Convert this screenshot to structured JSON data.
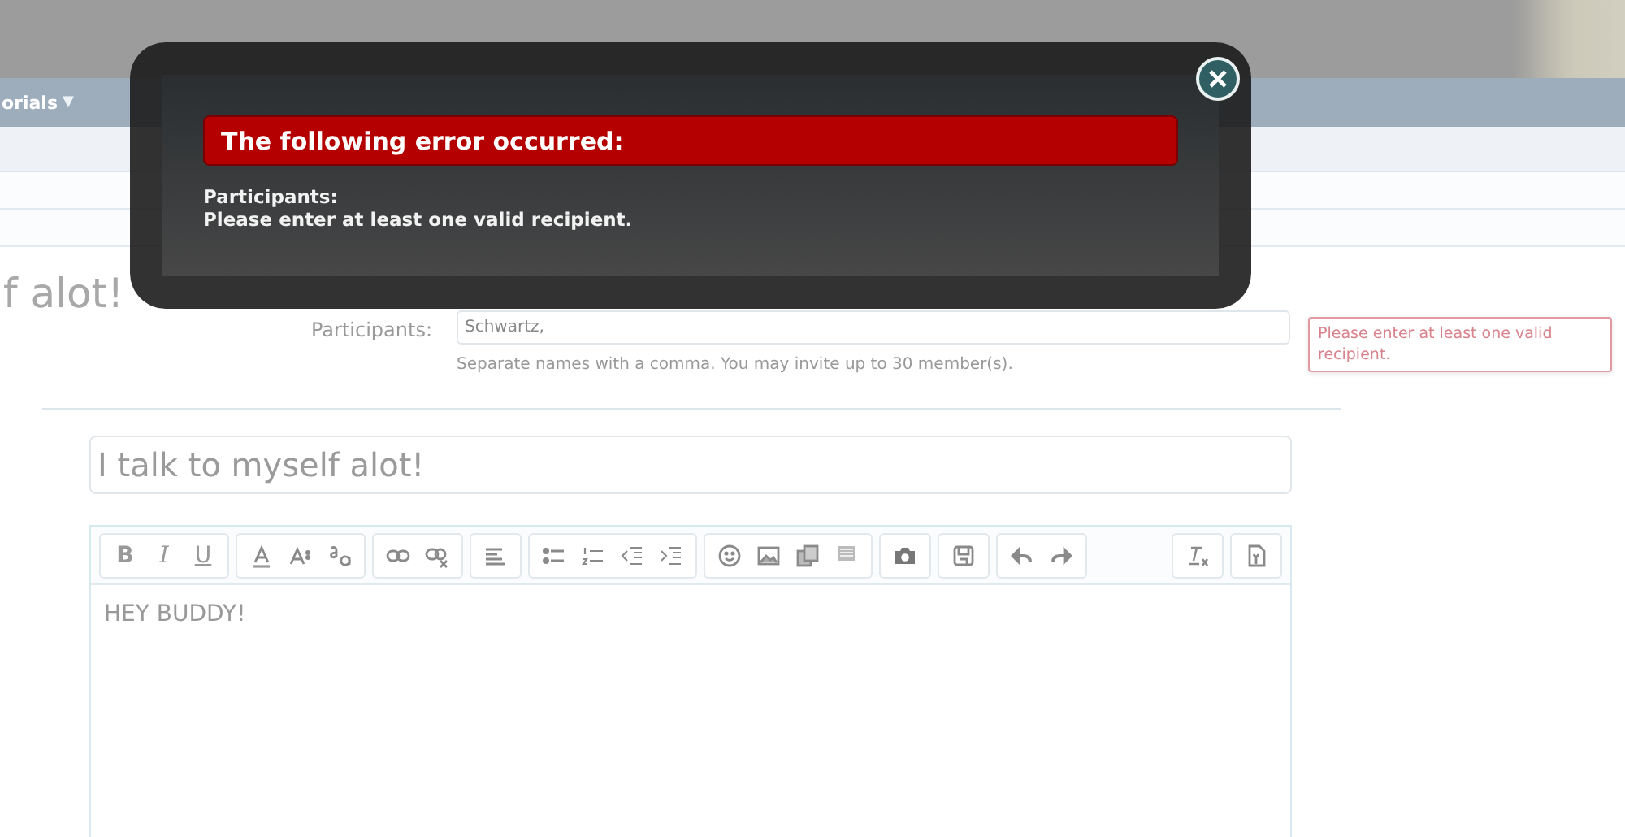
{
  "nav": {
    "items": [
      {
        "label": "orials",
        "caret": "▼"
      }
    ]
  },
  "page_title": "f alot!",
  "form": {
    "participants_label": "Participants:",
    "participants_value": "Schwartz,",
    "participants_hint": "Separate names with a comma. You may invite up to 30 member(s).",
    "participants_error": "Please enter at least one valid recipient.",
    "title_value": "I talk to myself alot!"
  },
  "editor": {
    "toolbar": [
      {
        "buttons": [
          {
            "label": "B",
            "kind": "bold"
          },
          {
            "label": "I",
            "kind": "italic"
          },
          {
            "label": "U",
            "kind": "underline"
          }
        ]
      },
      {
        "buttons": [
          {
            "kind": "icon"
          },
          {
            "kind": "icon"
          },
          {
            "kind": "icon"
          }
        ]
      },
      {
        "buttons": [
          {
            "kind": "icon"
          },
          {
            "kind": "icon"
          }
        ]
      },
      {
        "buttons": [
          {
            "kind": "icon"
          }
        ]
      },
      {
        "buttons": [
          {
            "kind": "icon"
          },
          {
            "kind": "icon"
          },
          {
            "kind": "icon"
          },
          {
            "kind": "icon"
          }
        ]
      },
      {
        "buttons": [
          {
            "kind": "icon"
          },
          {
            "kind": "icon"
          },
          {
            "kind": "icon"
          },
          {
            "kind": "icon"
          }
        ]
      },
      {
        "buttons": [
          {
            "kind": "icon"
          }
        ]
      },
      {
        "buttons": [
          {
            "kind": "icon"
          }
        ]
      },
      {
        "buttons": [
          {
            "kind": "icon"
          },
          {
            "kind": "icon"
          }
        ]
      }
    ],
    "toolbar_right": [
      {
        "buttons": [
          {
            "kind": "icon"
          }
        ]
      },
      {
        "buttons": [
          {
            "kind": "icon"
          }
        ]
      }
    ],
    "body": "HEY BUDDY!"
  },
  "error_dialog": {
    "heading": "The following error occurred:",
    "field": "Participants:",
    "message": "Please enter at least one valid recipient."
  }
}
